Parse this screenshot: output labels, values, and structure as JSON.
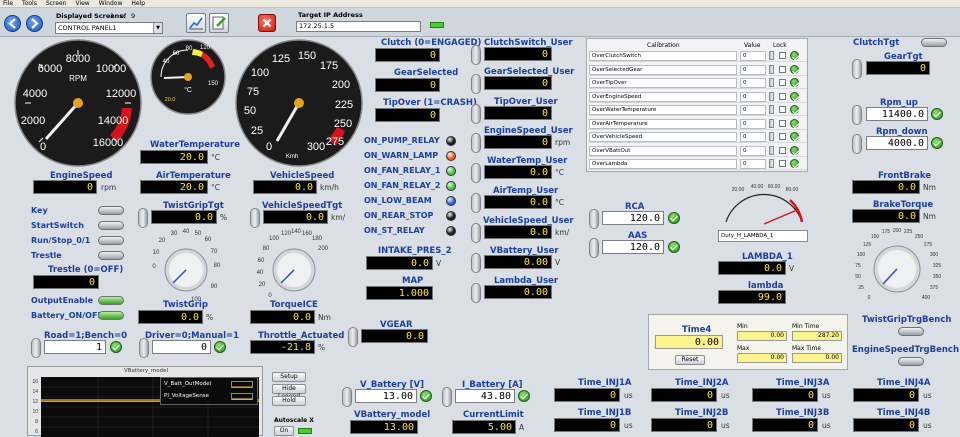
{
  "menu": [
    "File",
    "Tools",
    "Screen",
    "View",
    "Window",
    "Help"
  ],
  "toolbar": {
    "displayed_screens_label": "Displayed Screens:",
    "screen_index": "1",
    "screen_of": "of",
    "screen_total": "9",
    "screen_name": "CONTROL PANEL1",
    "target_ip_label": "Target IP Address",
    "target_ip": "172.25.1.5"
  },
  "gauges": {
    "rpm": {
      "label": "RPM",
      "ticks": [
        "6000",
        "8000",
        "10000",
        "12000",
        "4000",
        "14000",
        "2000",
        "0",
        "16000"
      ]
    },
    "temp": {
      "label": "°C",
      "ticks": [
        "120",
        "40",
        "60",
        "80",
        "20.0",
        "150"
      ]
    },
    "speed": {
      "label": "Kmh",
      "ticks": [
        "125",
        "150",
        "175",
        "100",
        "200",
        "75",
        "225",
        "50",
        "250",
        "25",
        "275",
        "0",
        "300"
      ]
    }
  },
  "left": {
    "water_temp": {
      "label": "WaterTemperature",
      "value": "20.0",
      "unit": "°C"
    },
    "engine_speed": {
      "label": "EngineSpeed",
      "value": "0",
      "unit": "rpm"
    },
    "air_temp": {
      "label": "AirTemperature",
      "value": "20.0",
      "unit": "°C"
    },
    "vehicle_speed": {
      "label": "VehicleSpeed",
      "value": "0.0",
      "unit": "km/h"
    },
    "twist_grip_tgt": {
      "label": "TwistGripTgt",
      "value": "0.0",
      "unit": "%"
    },
    "vehicle_speed_tgt": {
      "label": "VehicleSpeedTgt",
      "value": "0.0",
      "unit": "km/"
    },
    "key": "Key",
    "start_switch": "StartSwitch",
    "run_stop": "Run/Stop_0/1",
    "trestle": "Trestle",
    "trestle_num": {
      "label": "Trestle (0=OFF)",
      "value": "0"
    },
    "knob1_ticks": [
      "30",
      "40",
      "50",
      "60",
      "20",
      "70",
      "10",
      "80",
      "0",
      "100",
      "90"
    ],
    "knob2_ticks": [
      "120",
      "140",
      "160",
      "180",
      "100",
      "200",
      "80",
      "60",
      "40",
      "20",
      "0"
    ],
    "output_enable": "OutputEnable",
    "battery_onoff": "Battery_ON/OFF",
    "twist_grip": {
      "label": "TwistGrip",
      "value": "0.0",
      "unit": "%"
    },
    "torque_ice": {
      "label": "TorqueICE",
      "value": "0.0",
      "unit": "Nm"
    },
    "road_bench": {
      "label": "Road=1;Bench=0",
      "value": "1"
    },
    "driver_manual": {
      "label": "Driver=0;Manual=1",
      "value": "0"
    },
    "throttle": {
      "label": "Throttle_Actuated",
      "value": "-21.8",
      "unit": "%"
    }
  },
  "mid": {
    "clutch": {
      "label": "Clutch (0=ENGAGED)",
      "value": "0"
    },
    "gear_selected": {
      "label": "GearSelected",
      "value": "0"
    },
    "tipover": {
      "label": "TipOver (1=CRASH)",
      "value": "0"
    },
    "relays": [
      {
        "label": "ON_PUMP_RELAY",
        "color": "#1a1a1a"
      },
      {
        "label": "ON_WARN_LAMP",
        "color": "#e8612c"
      },
      {
        "label": "ON_FAN_RELAY_1",
        "color": "#49c63a"
      },
      {
        "label": "ON_FAN_RELAY_2",
        "color": "#49c63a"
      },
      {
        "label": "ON_LOW_BEAM",
        "color": "#2e62d6"
      },
      {
        "label": "ON_REAR_STOP",
        "color": "#1a1a1a"
      },
      {
        "label": "ON_ST_RELAY",
        "color": "#1a1a1a"
      }
    ],
    "intake_pres": {
      "label": "INTAKE_PRES_2",
      "value": "0.0",
      "unit": "V"
    },
    "map": {
      "label": "MAP",
      "value": "1.000"
    },
    "vgear": {
      "label": "VGEAR",
      "value": "0.0"
    }
  },
  "user": {
    "clutch_switch": {
      "label": "ClutchSwitch_User",
      "value": "0"
    },
    "gear_selected": {
      "label": "GearSelected_User",
      "value": "0"
    },
    "tipover": {
      "label": "TipOver_User",
      "value": "0"
    },
    "engine_speed": {
      "label": "EngineSpeed_User",
      "value": "0",
      "unit": "rpm"
    },
    "water_temp": {
      "label": "WaterTemp_User",
      "value": "0.0",
      "unit": "°C"
    },
    "air_temp": {
      "label": "AirTemp_User",
      "value": "0.0",
      "unit": "°C"
    },
    "vehicle_speed": {
      "label": "VehicleSpeed_User",
      "value": "0.0",
      "unit": "km/"
    },
    "vbattery": {
      "label": "VBattery_User",
      "value": "0.00",
      "unit": "V"
    },
    "lambda": {
      "label": "Lambda_User",
      "value": "0.00"
    }
  },
  "calib": {
    "headers": [
      "Calibration",
      "Value",
      "Lock"
    ],
    "rows": [
      "OverClutchSwitch",
      "OverSelectedGear",
      "OverTipOver",
      "OverEngineSpeed",
      "OverWaterTemperature",
      "OverAirTemperature",
      "OverVehicleSpeed",
      "OverVBattOut",
      "OverLambda"
    ],
    "value": "0"
  },
  "rca": {
    "label": "RCA",
    "value": "120.0"
  },
  "aas": {
    "label": "AAS",
    "value": "120.0"
  },
  "lambda_gauge": {
    "ticks": [
      "20.00",
      "40.00",
      "60.00",
      "80.00"
    ],
    "caption": "Duty_H_LAMBDA_1"
  },
  "lambda1": {
    "label": "LAMBDA_1",
    "value": "0.0",
    "unit": "V"
  },
  "lambda": {
    "label": "lambda",
    "value": "99.0"
  },
  "time4": {
    "label": "Time4",
    "value": "0.00",
    "min_label": "Min",
    "min_value": "0.00",
    "min_time_label": "Min Time",
    "min_time_value": "287.20",
    "max_label": "Max",
    "max_value": "0.00",
    "max_time_label": "Max Time",
    "max_time_value": "0.00",
    "reset": "Reset"
  },
  "right": {
    "clutch_tgt": "ClutchTgt",
    "gear_tgt": {
      "label": "GearTgt",
      "value": "0"
    },
    "rpm_up": {
      "label": "Rpm_up",
      "value": "11400.0"
    },
    "rpm_down": {
      "label": "Rpm_down",
      "value": "4000.0"
    },
    "front_brake": {
      "label": "FrontBrake",
      "value": "0.0",
      "unit": "Nm"
    },
    "brake_torque": {
      "label": "BrakeTorque",
      "value": "0.0",
      "unit": "Nm"
    },
    "knob_ticks": [
      "175",
      "200",
      "225",
      "150",
      "250",
      "125",
      "275",
      "100",
      "300",
      "75",
      "325",
      "50",
      "350",
      "25",
      "375",
      "0",
      "400"
    ],
    "twist_grip_trg_bench": "TwistGripTrgBench",
    "engine_speed_trg_bench": "EngineSpeedTrgBench"
  },
  "graph": {
    "title": "VBattery_model",
    "legend": [
      "V_Batt_OutModel",
      "PI_VoltageSense"
    ],
    "yticks": [
      "16",
      "14",
      "12",
      "10",
      "8",
      "6"
    ],
    "buttons": [
      "Setup",
      "Hide Legend",
      "Hold"
    ],
    "autoscale": "Autoscale X",
    "autoscale_btn": "On"
  },
  "bottom": {
    "v_battery": {
      "label": "V_Battery [V]",
      "value": "13.00"
    },
    "i_battery": {
      "label": "I_Battery [A]",
      "value": "43.80"
    },
    "vbattery_model": {
      "label": "VBattery_model",
      "value": "13.00"
    },
    "current_limit": {
      "label": "CurrentLimit",
      "value": "5.00",
      "unit": "A"
    },
    "inj": [
      {
        "label": "Time_INJ1A",
        "value": "0",
        "unit": "us"
      },
      {
        "label": "Time_INJ2A",
        "value": "0",
        "unit": "us"
      },
      {
        "label": "Time_INJ3A",
        "value": "0",
        "unit": "us"
      },
      {
        "label": "Time_INJ4A",
        "value": "0",
        "unit": "us"
      },
      {
        "label": "Time_INJ1B",
        "value": "0",
        "unit": "us"
      },
      {
        "label": "Time_INJ2B",
        "value": "0",
        "unit": "us"
      },
      {
        "label": "Time_INJ3B",
        "value": "0",
        "unit": "us"
      },
      {
        "label": "Time_INJ4B",
        "value": "0",
        "unit": "us"
      }
    ]
  }
}
